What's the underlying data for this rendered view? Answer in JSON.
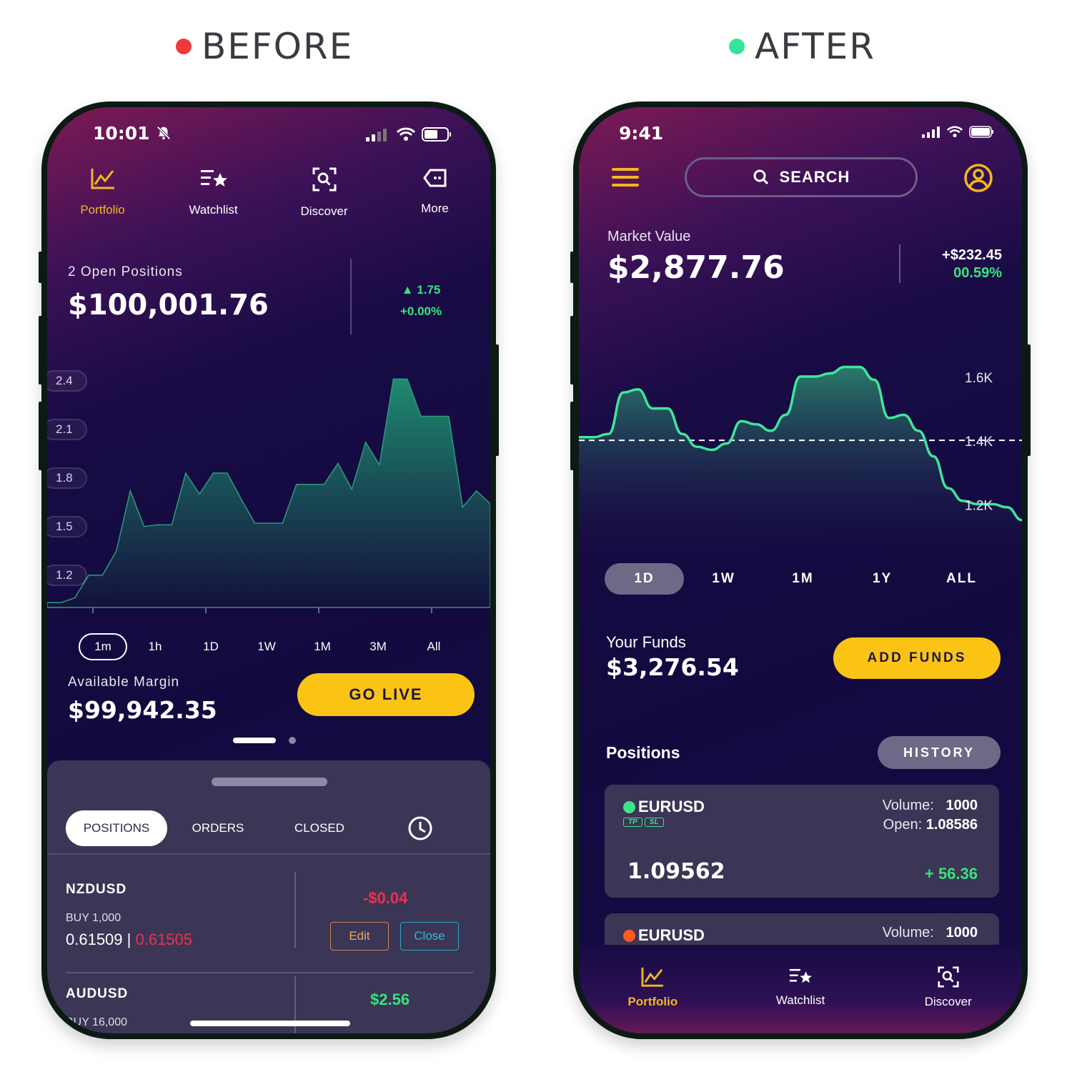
{
  "headings": {
    "before": "BEFORE",
    "after": "AFTER",
    "before_dot_color": "#f03a3a",
    "after_dot_color": "#35e39b"
  },
  "before": {
    "status_time": "10:01",
    "nav": [
      {
        "label": "Portfolio",
        "icon": "chart-icon",
        "active": true
      },
      {
        "label": "Watchlist",
        "icon": "list-star-icon",
        "active": false
      },
      {
        "label": "Discover",
        "icon": "scan-search-icon",
        "active": false
      },
      {
        "label": "More",
        "icon": "tag-icon",
        "active": false
      }
    ],
    "summary": {
      "label": "2 Open Positions",
      "value": "$100,001.76",
      "change": "1.75",
      "change_pct": "+0.00%"
    },
    "chart_data": {
      "type": "area",
      "y_ticks": [
        "2.4",
        "2.1",
        "1.8",
        "1.5",
        "1.2"
      ],
      "ylim": [
        1.0,
        2.5
      ],
      "values": [
        1.03,
        1.03,
        1.06,
        1.2,
        1.2,
        1.35,
        1.72,
        1.5,
        1.51,
        1.51,
        1.83,
        1.7,
        1.83,
        1.83,
        1.67,
        1.52,
        1.52,
        1.52,
        1.76,
        1.76,
        1.76,
        1.89,
        1.73,
        2.02,
        1.88,
        2.41,
        2.41,
        2.18,
        2.18,
        2.18,
        1.62,
        1.72,
        1.64
      ]
    },
    "ranges": [
      "1m",
      "1h",
      "1D",
      "1W",
      "1M",
      "3M",
      "All"
    ],
    "active_range": "1m",
    "margin": {
      "label": "Available Margin",
      "value": "$99,942.35"
    },
    "go_live": "GO LIVE",
    "tabs": [
      "POSITIONS",
      "ORDERS",
      "CLOSED"
    ],
    "positions": [
      {
        "symbol": "NZDUSD",
        "detail": "BUY 1,000",
        "open": "0.61509",
        "current": "0.61505",
        "pl": "-$0.04",
        "edit": "Edit",
        "close": "Close"
      },
      {
        "symbol": "AUDUSD",
        "detail": "BUY 16,000",
        "pl": "$2.56"
      }
    ]
  },
  "after": {
    "status_time": "9:41",
    "search": "SEARCH",
    "market": {
      "label": "Market Value",
      "value": "$2,877.76",
      "change": "+$232.45",
      "change_pct": "00.59%"
    },
    "chart_data": {
      "type": "area",
      "y_ticks": [
        "1.6K",
        "1.4K",
        "1.2K"
      ],
      "ylim": [
        1.1,
        1.75
      ],
      "baseline": 1.4,
      "values": [
        1.41,
        1.41,
        1.42,
        1.55,
        1.56,
        1.5,
        1.5,
        1.42,
        1.38,
        1.37,
        1.39,
        1.46,
        1.45,
        1.43,
        1.48,
        1.6,
        1.6,
        1.61,
        1.63,
        1.63,
        1.59,
        1.47,
        1.48,
        1.43,
        1.35,
        1.25,
        1.21,
        1.2,
        1.2,
        1.19,
        1.15
      ]
    },
    "periods": [
      "1D",
      "1W",
      "1M",
      "1Y",
      "ALL"
    ],
    "active_period": "1D",
    "funds": {
      "label": "Your Funds",
      "value": "$3,276.54",
      "button": "ADD FUNDS"
    },
    "positions_title": "Positions",
    "history_button": "HISTORY",
    "cards": [
      {
        "symbol": "EURUSD",
        "dot_color": "#3de38b",
        "tag_tp": "TP",
        "tag_sl": "SL",
        "volume_label": "Volume:",
        "volume": "1000",
        "open_label": "Open:",
        "open": "1.08586",
        "price": "1.09562",
        "pl": "+ 56.36"
      },
      {
        "symbol": "EURUSD",
        "dot_color": "#ff5a1f",
        "volume_label": "Volume:",
        "volume": "1000"
      }
    ],
    "bottom_nav": [
      {
        "label": "Portfolio",
        "icon": "chart-icon",
        "active": true
      },
      {
        "label": "Watchlist",
        "icon": "list-star-icon",
        "active": false
      },
      {
        "label": "Discover",
        "icon": "scan-search-icon",
        "active": false
      }
    ]
  }
}
